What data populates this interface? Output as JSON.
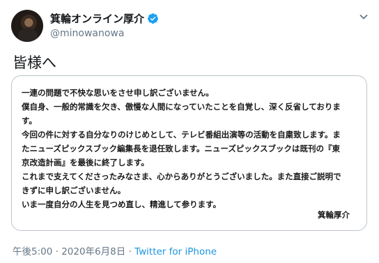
{
  "author": {
    "display_name": "箕輪オンライン厚介",
    "handle": "@minowanowa",
    "verified_color": "#1da1f2"
  },
  "menu": {
    "icon": "chevron-down-icon"
  },
  "tweet": {
    "text": "皆様へ"
  },
  "statement": {
    "lines": [
      "一連の問題で不快な思いをさせ申し訳ございません。",
      "僕自身、一般的常識を欠き、傲慢な人間になっていたことを自覚し、深く反省しておりま",
      "す。",
      "今回の件に対する自分なりのけじめとして、テレビ番組出演等の活動を自粛致します。ま",
      "たニューズピックスブック編集長を退任致します。ニューズピックスブックは既刊の『東",
      "京改造計画』を最後に終了します。",
      "これまで支えてくださったみなさま、心からありがとうございました。また直接ご説明で",
      "きずに申し訳ございません。",
      "いま一度自分の人生を見つめ直し、精進して参ります。"
    ],
    "signature": "箕輪厚介"
  },
  "meta": {
    "timestamp": "午後5:00 · 2020年6月8日",
    "separator": " · ",
    "source": "Twitter for iPhone"
  }
}
